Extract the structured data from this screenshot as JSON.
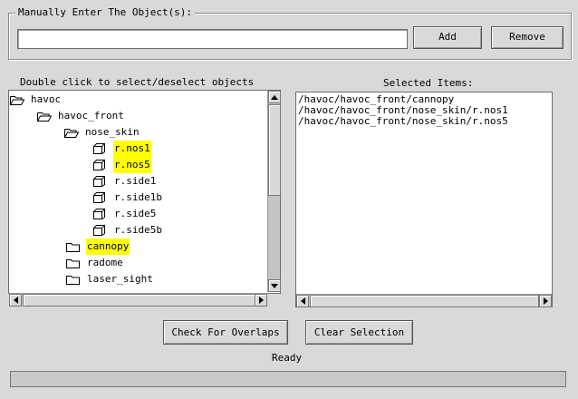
{
  "manual_entry": {
    "title": "Manually Enter The Object(s):",
    "value": "",
    "add_label": "Add",
    "remove_label": "Remove"
  },
  "tree": {
    "header": "Double click to select/deselect objects",
    "items": [
      {
        "label": "havoc",
        "icon": "folder-open-icon",
        "highlighted": false
      },
      {
        "label": "havoc_front",
        "icon": "folder-open-icon",
        "highlighted": false
      },
      {
        "label": "nose_skin",
        "icon": "folder-open-icon",
        "highlighted": false
      },
      {
        "label": "r.nos1",
        "icon": "object-icon",
        "highlighted": true
      },
      {
        "label": "r.nos5",
        "icon": "object-icon",
        "highlighted": true
      },
      {
        "label": "r.side1",
        "icon": "object-icon",
        "highlighted": false
      },
      {
        "label": "r.side1b",
        "icon": "object-icon",
        "highlighted": false
      },
      {
        "label": "r.side5",
        "icon": "object-icon",
        "highlighted": false
      },
      {
        "label": "r.side5b",
        "icon": "object-icon",
        "highlighted": false
      },
      {
        "label": "cannopy",
        "icon": "folder-closed-icon",
        "highlighted": true
      },
      {
        "label": "radome",
        "icon": "folder-closed-icon",
        "highlighted": false
      },
      {
        "label": "laser_sight",
        "icon": "folder-closed-icon",
        "highlighted": false
      }
    ]
  },
  "selected": {
    "header": "Selected Items:",
    "items": [
      "/havoc/havoc_front/cannopy",
      "/havoc/havoc_front/nose_skin/r.nos1",
      "/havoc/havoc_front/nose_skin/r.nos5"
    ]
  },
  "actions": {
    "check_overlaps_label": "Check For Overlaps",
    "clear_selection_label": "Clear Selection"
  },
  "status": "Ready",
  "colors": {
    "highlight": "#ffff00",
    "background": "#d9d9d9"
  }
}
